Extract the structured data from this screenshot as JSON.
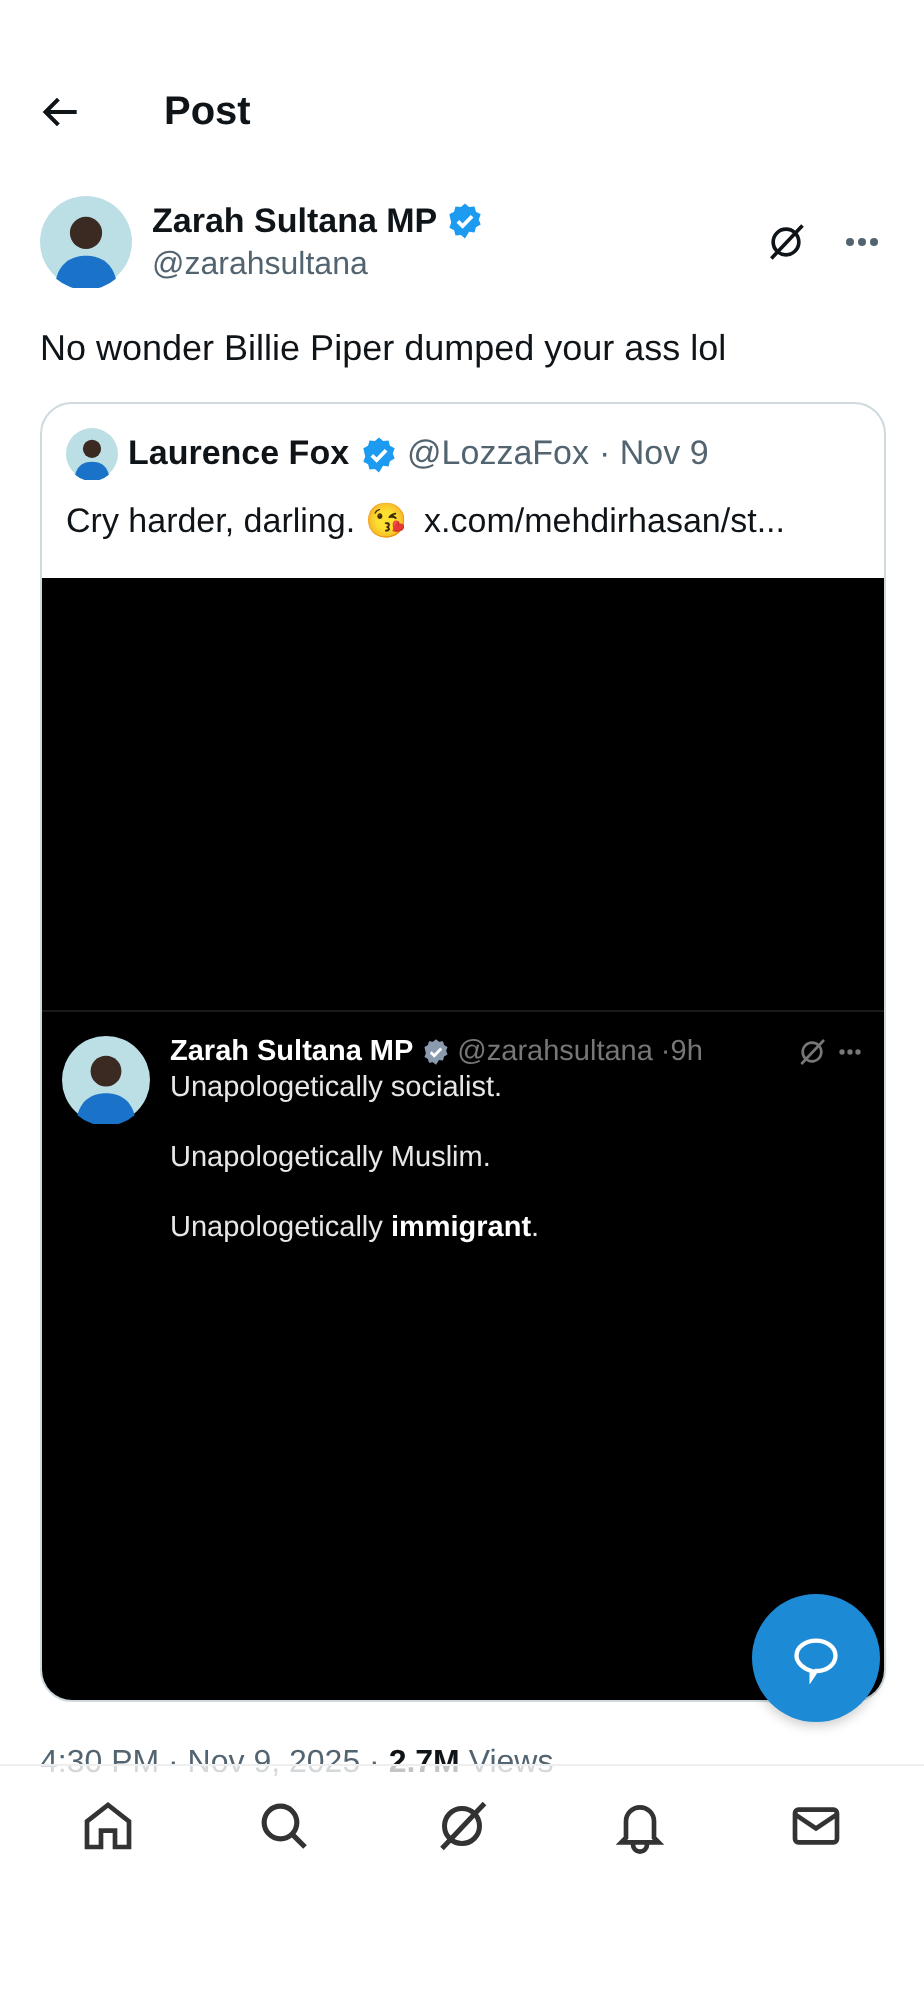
{
  "header": {
    "title": "Post"
  },
  "post": {
    "name": "Zarah Sultana MP",
    "verified": true,
    "handle": "@zarahsultana",
    "text": "No wonder Billie Piper dumped your ass lol",
    "quote": {
      "name": "Laurence Fox",
      "verified": true,
      "handle": "@LozzaFox",
      "time": "· Nov 9",
      "text": "Cry harder, darling. 😘",
      "link": "x.com/mehdirhasan/st...",
      "media": {
        "name": "Zarah Sultana MP",
        "verified": true,
        "handle": "@zarahsultana",
        "time": "·9h",
        "lines": [
          "Unapologetically socialist.",
          "Unapologetically Muslim.",
          "Unapologetically **immigrant**."
        ]
      }
    },
    "meta": {
      "time": "4:30 PM · Nov 9, 2025 · ",
      "views_count": "2.7M",
      "views_label": " Views"
    }
  },
  "nav": [
    {
      "kind": "home"
    },
    {
      "kind": "search"
    },
    {
      "kind": "grok"
    },
    {
      "kind": "notifications"
    },
    {
      "kind": "messages"
    }
  ]
}
